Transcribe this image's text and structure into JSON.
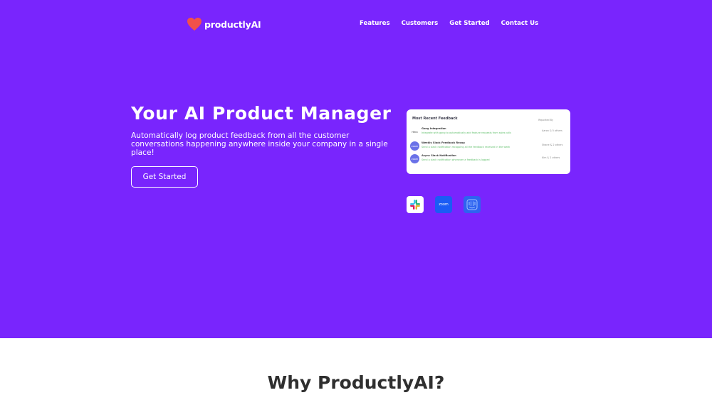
{
  "header": {
    "logo_text": "productlyAI",
    "nav": [
      "Features",
      "Customers",
      "Get Started",
      "Contact Us"
    ]
  },
  "hero": {
    "title": "Your AI Product Manager",
    "subtitle": "Automatically log product feedback from all the customer conversations happening anywhere inside your company in a single place!",
    "cta_label": "Get Started"
  },
  "feedback_card": {
    "title": "Most Recent Feedback",
    "column_label": "Reported By",
    "items": [
      {
        "avatar": "Hero",
        "name": "Gong Integration",
        "desc": "Integrate with gong to automatically add feature requests from sales calls",
        "reported_by": "Aaron & 5 others"
      },
      {
        "avatar": "zoom",
        "name": "Weekly Slack Feedback Recap",
        "desc": "Send a slack notification recapping all the feedback received in the week",
        "reported_by": "Shane & 2 others"
      },
      {
        "avatar": "zoom",
        "name": "Async Slack Notification",
        "desc": "Send a slack notification whenever a feedback is logged",
        "reported_by": "Kim & 2 others"
      }
    ]
  },
  "integrations": {
    "zoom_label": "zoom"
  },
  "section2": {
    "title": "Why ProductlyAI?"
  },
  "colors": {
    "brand_purple": "#7925fd",
    "heart_red": "#f2514b",
    "feedback_green": "#5fbf6a"
  }
}
